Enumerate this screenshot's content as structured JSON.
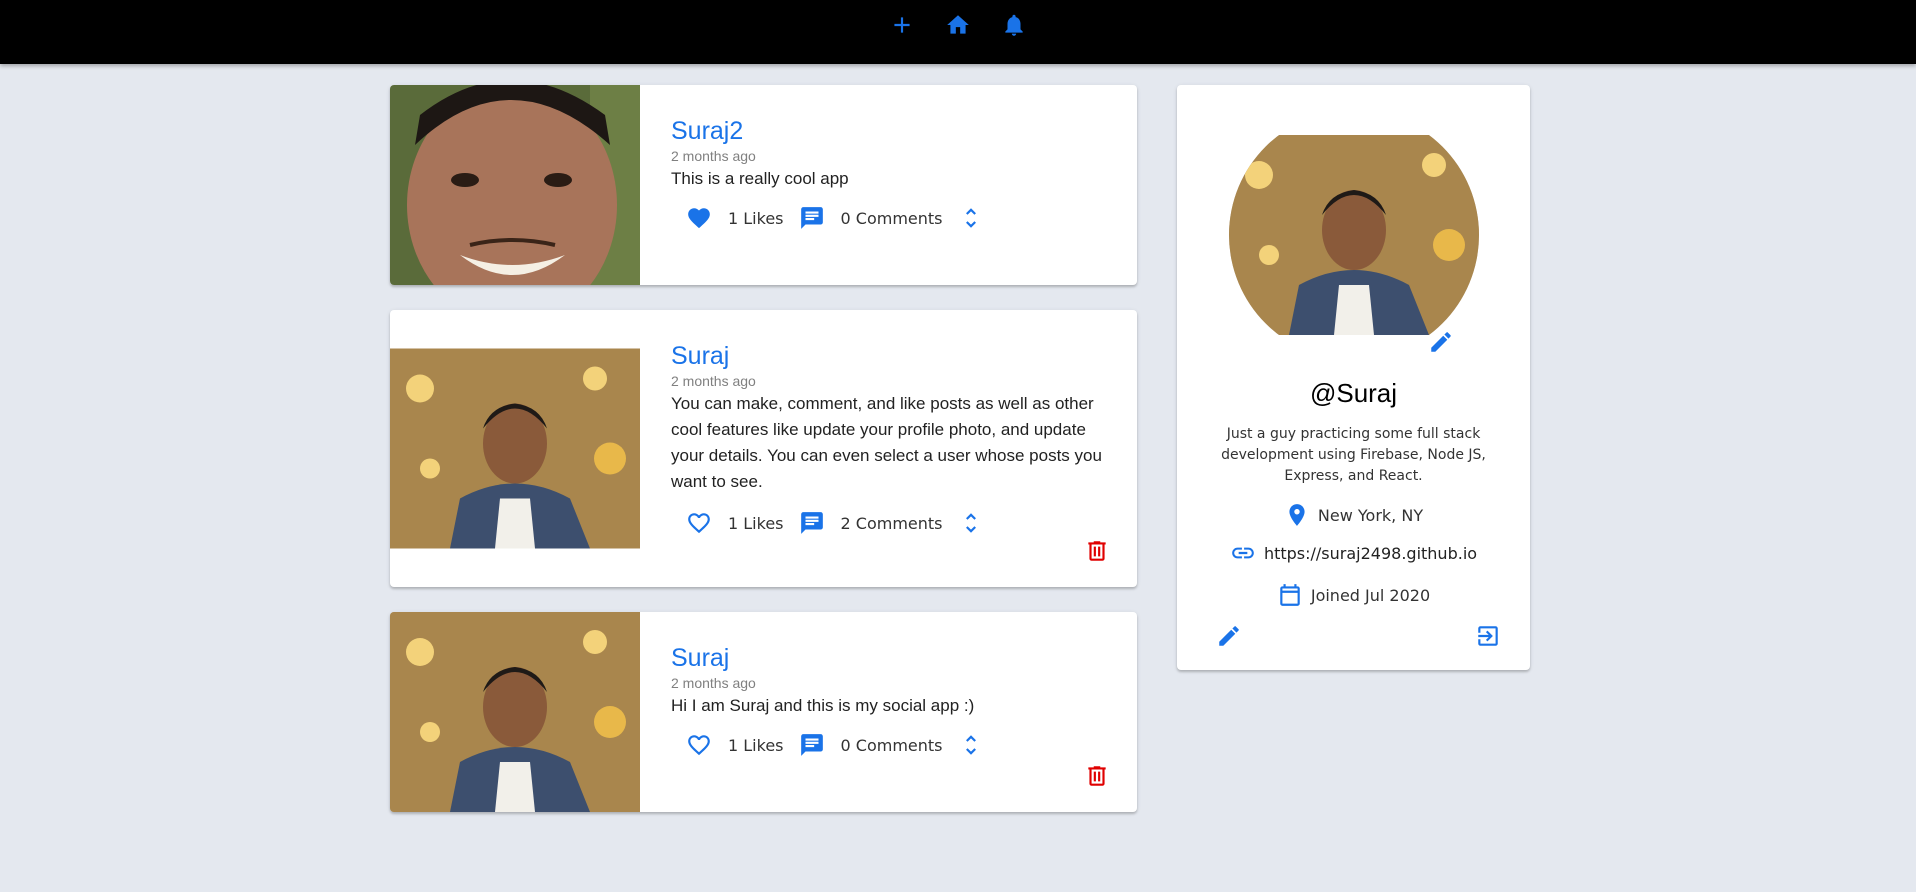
{
  "navbar": {
    "icons": [
      "add-icon",
      "home-icon",
      "notifications-icon"
    ],
    "accent": "#1a73e8",
    "background": "#000000"
  },
  "posts": [
    {
      "user": "Suraj2",
      "date": "2 months ago",
      "body": "This is a really cool app",
      "likes": "1 Likes",
      "comments": "0 Comments",
      "liked": true,
      "deletable": false
    },
    {
      "user": "Suraj",
      "date": "2 months ago",
      "body": "You can make, comment, and like posts as well as other cool features like update your profile photo, and update your details. You can even select a user whose posts you want to see.",
      "likes": "1 Likes",
      "comments": "2 Comments",
      "liked": false,
      "deletable": true
    },
    {
      "user": "Suraj",
      "date": "2 months ago",
      "body": "Hi I am Suraj and this is my social app :)",
      "likes": "1 Likes",
      "comments": "0 Comments",
      "liked": false,
      "deletable": true
    }
  ],
  "profile": {
    "handle": "@Suraj",
    "bio": "Just a guy practicing some full stack development using Firebase, Node JS, Express, and React.",
    "location": "New York, NY",
    "website": "https://suraj2498.github.io",
    "joined": "Joined Jul 2020"
  },
  "colors": {
    "accent": "#1a73e8",
    "delete": "#e00000",
    "page_bg": "#e4e8ef"
  }
}
